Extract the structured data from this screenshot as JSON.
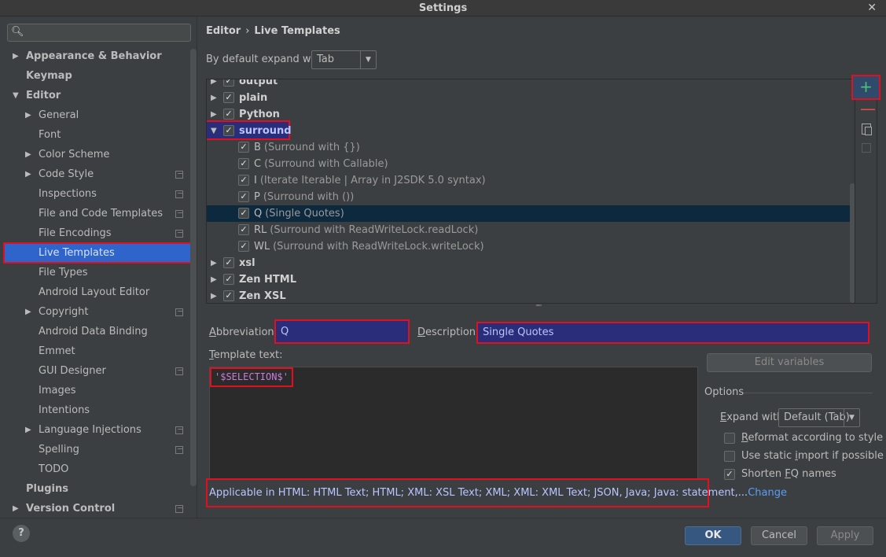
{
  "window": {
    "title": "Settings",
    "close_glyph": "✕"
  },
  "search": {
    "placeholder": "",
    "icon": "search-icon"
  },
  "sidebar": {
    "items": [
      {
        "label": "Appearance & Behavior",
        "bold": true,
        "arrow": "▶"
      },
      {
        "label": "Keymap",
        "bold": true
      },
      {
        "label": "Editor",
        "bold": true,
        "arrow": "▼"
      },
      {
        "label": "General",
        "arrow": "▶"
      },
      {
        "label": "Font"
      },
      {
        "label": "Color Scheme",
        "arrow": "▶"
      },
      {
        "label": "Code Style",
        "arrow": "▶",
        "copy": true
      },
      {
        "label": "Inspections",
        "copy": true
      },
      {
        "label": "File and Code Templates",
        "copy": true
      },
      {
        "label": "File Encodings",
        "copy": true
      },
      {
        "label": "Live Templates",
        "selected": true
      },
      {
        "label": "File Types"
      },
      {
        "label": "Android Layout Editor"
      },
      {
        "label": "Copyright",
        "arrow": "▶",
        "copy": true
      },
      {
        "label": "Android Data Binding"
      },
      {
        "label": "Emmet"
      },
      {
        "label": "GUI Designer",
        "copy": true
      },
      {
        "label": "Images"
      },
      {
        "label": "Intentions"
      },
      {
        "label": "Language Injections",
        "arrow": "▶",
        "copy": true
      },
      {
        "label": "Spelling",
        "copy": true
      },
      {
        "label": "TODO"
      },
      {
        "label": "Plugins",
        "bold": true
      },
      {
        "label": "Version Control",
        "bold": true,
        "arrow": "▶",
        "copy": true
      }
    ]
  },
  "breadcrumb": {
    "part1": "Editor",
    "sep": "›",
    "part2": "Live Templates"
  },
  "expand": {
    "label": "By default expand with",
    "value": "Tab"
  },
  "template_tree": {
    "rows": [
      {
        "name": "output",
        "group": true,
        "checked": true
      },
      {
        "name": "plain",
        "group": true,
        "checked": true
      },
      {
        "name": "Python",
        "group": true,
        "checked": true
      },
      {
        "name": "surround",
        "group": true,
        "checked": true,
        "expanded": true
      },
      {
        "name": "B",
        "desc": "(Surround with {})",
        "checked": true
      },
      {
        "name": "C",
        "desc": "(Surround with Callable)",
        "checked": true
      },
      {
        "name": "I",
        "desc": "(Iterate Iterable | Array in J2SDK 5.0 syntax)",
        "checked": true
      },
      {
        "name": "P",
        "desc": "(Surround with ())",
        "checked": true
      },
      {
        "name": "Q",
        "desc": "(Single Quotes)",
        "checked": true,
        "selected": true
      },
      {
        "name": "RL",
        "desc": "(Surround with ReadWriteLock.readLock)",
        "checked": true
      },
      {
        "name": "WL",
        "desc": "(Surround with ReadWriteLock.writeLock)",
        "checked": true
      },
      {
        "name": "xsl",
        "group": true,
        "checked": true
      },
      {
        "name": "Zen HTML",
        "group": true,
        "checked": true
      },
      {
        "name": "Zen XSL",
        "group": true,
        "checked": true
      }
    ]
  },
  "toolbar": {
    "add": "+",
    "remove": "—"
  },
  "abbreviation": {
    "label_a": "A",
    "label_rest": "bbreviation:",
    "value": "Q"
  },
  "description": {
    "label_d": "D",
    "label_rest": "escription:",
    "value": "Single Quotes"
  },
  "template_text": {
    "label_t": "T",
    "label_rest": "emplate text:",
    "value": "'$SELECTION$'"
  },
  "edit_variables": "Edit variables",
  "options": {
    "title": "Options",
    "expand_label_e": "E",
    "expand_label_rest": "xpand with",
    "expand_value": "Default (Tab)",
    "reformat": {
      "label_u": "R",
      "label_rest": "eformat according to style",
      "checked": false
    },
    "static_import": {
      "label_pre": "Use static ",
      "label_u": "i",
      "label_rest": "mport if possible",
      "checked": false
    },
    "shorten": {
      "label_pre": "Shorten ",
      "label_u": "F",
      "label_rest": "Q names",
      "checked": true
    }
  },
  "applicable": {
    "text": "Applicable in HTML: HTML Text; HTML; XML: XSL Text; XML; XML: XML Text; JSON, Java; Java: statement,...",
    "change": "Change"
  },
  "buttons": {
    "help": "?",
    "ok": "OK",
    "cancel": "Cancel",
    "apply": "Apply"
  }
}
